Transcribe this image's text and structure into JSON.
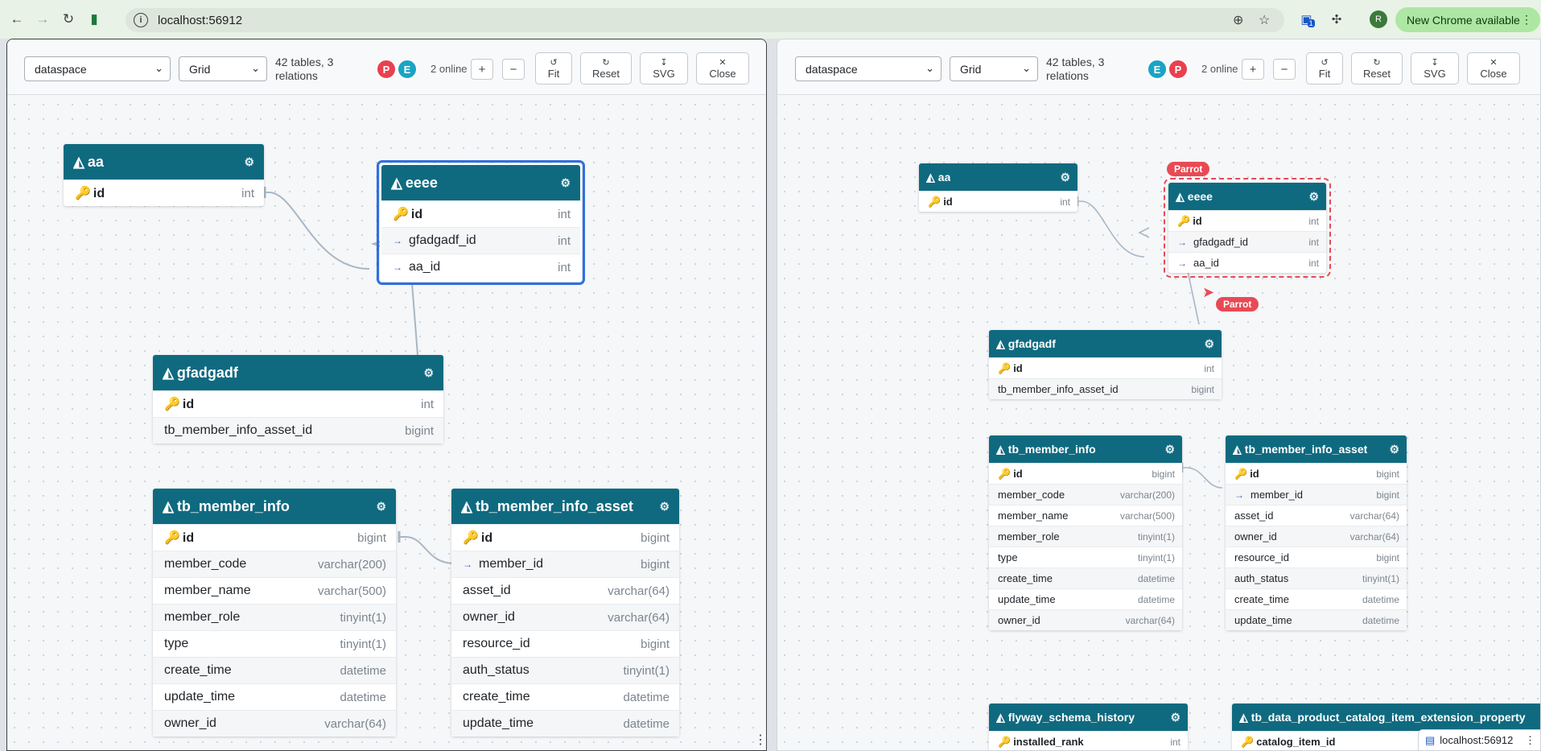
{
  "browser": {
    "url": "localhost:56912",
    "new_chrome": "New Chrome available",
    "ext_badge": "1",
    "profile_initial": "R"
  },
  "toolbar": {
    "schema": "dataspace",
    "layout": "Grid",
    "stats": "42 tables, 3 relations",
    "online": "2 online",
    "zoom_in": "+",
    "zoom_out": "−",
    "fit": "Fit",
    "reset": "Reset",
    "svg": "SVG",
    "close": "Close"
  },
  "left_pane": {
    "avatars": [
      {
        "letter": "P",
        "color": "#e8414f"
      },
      {
        "letter": "E",
        "color": "#1ba3c6"
      }
    ]
  },
  "right_pane": {
    "avatars": [
      {
        "letter": "E",
        "color": "#1ba3c6"
      },
      {
        "letter": "P",
        "color": "#e8414f"
      }
    ],
    "presence_label": "Parrot"
  },
  "tables": {
    "aa": {
      "name": "aa",
      "rows": [
        {
          "name": "id",
          "type": "int",
          "pk": true
        }
      ]
    },
    "eeee": {
      "name": "eeee",
      "rows": [
        {
          "name": "id",
          "type": "int",
          "pk": true
        },
        {
          "name": "gfadgadf_id",
          "type": "int",
          "fk": true
        },
        {
          "name": "aa_id",
          "type": "int",
          "fk": true
        }
      ]
    },
    "gfadgadf": {
      "name": "gfadgadf",
      "rows": [
        {
          "name": "id",
          "type": "int",
          "pk": true
        },
        {
          "name": "tb_member_info_asset_id",
          "type": "bigint"
        }
      ]
    },
    "tb_member_info": {
      "name": "tb_member_info",
      "rows": [
        {
          "name": "id",
          "type": "bigint",
          "pk": true
        },
        {
          "name": "member_code",
          "type": "varchar(200)"
        },
        {
          "name": "member_name",
          "type": "varchar(500)"
        },
        {
          "name": "member_role",
          "type": "tinyint(1)"
        },
        {
          "name": "type",
          "type": "tinyint(1)"
        },
        {
          "name": "create_time",
          "type": "datetime"
        },
        {
          "name": "update_time",
          "type": "datetime"
        },
        {
          "name": "owner_id",
          "type": "varchar(64)"
        }
      ]
    },
    "tb_member_info_asset": {
      "name": "tb_member_info_asset",
      "rows": [
        {
          "name": "id",
          "type": "bigint",
          "pk": true
        },
        {
          "name": "member_id",
          "type": "bigint",
          "fk": true
        },
        {
          "name": "asset_id",
          "type": "varchar(64)"
        },
        {
          "name": "owner_id",
          "type": "varchar(64)"
        },
        {
          "name": "resource_id",
          "type": "bigint"
        },
        {
          "name": "auth_status",
          "type": "tinyint(1)"
        },
        {
          "name": "create_time",
          "type": "datetime"
        },
        {
          "name": "update_time",
          "type": "datetime"
        }
      ]
    },
    "flyway_schema_history": {
      "name": "flyway_schema_history",
      "rows": [
        {
          "name": "installed_rank",
          "type": "int",
          "pk": true
        }
      ]
    },
    "tb_data_product_catalog": {
      "name": "tb_data_product_catalog_item_extension_property",
      "rows": [
        {
          "name": "catalog_item_id",
          "type": ""
        }
      ]
    }
  },
  "status_bar": {
    "url": "localhost:56912"
  },
  "colors": {
    "header": "#0f6a80",
    "selection_blue": "#2f6fe0",
    "presence_red": "#e84a55"
  }
}
